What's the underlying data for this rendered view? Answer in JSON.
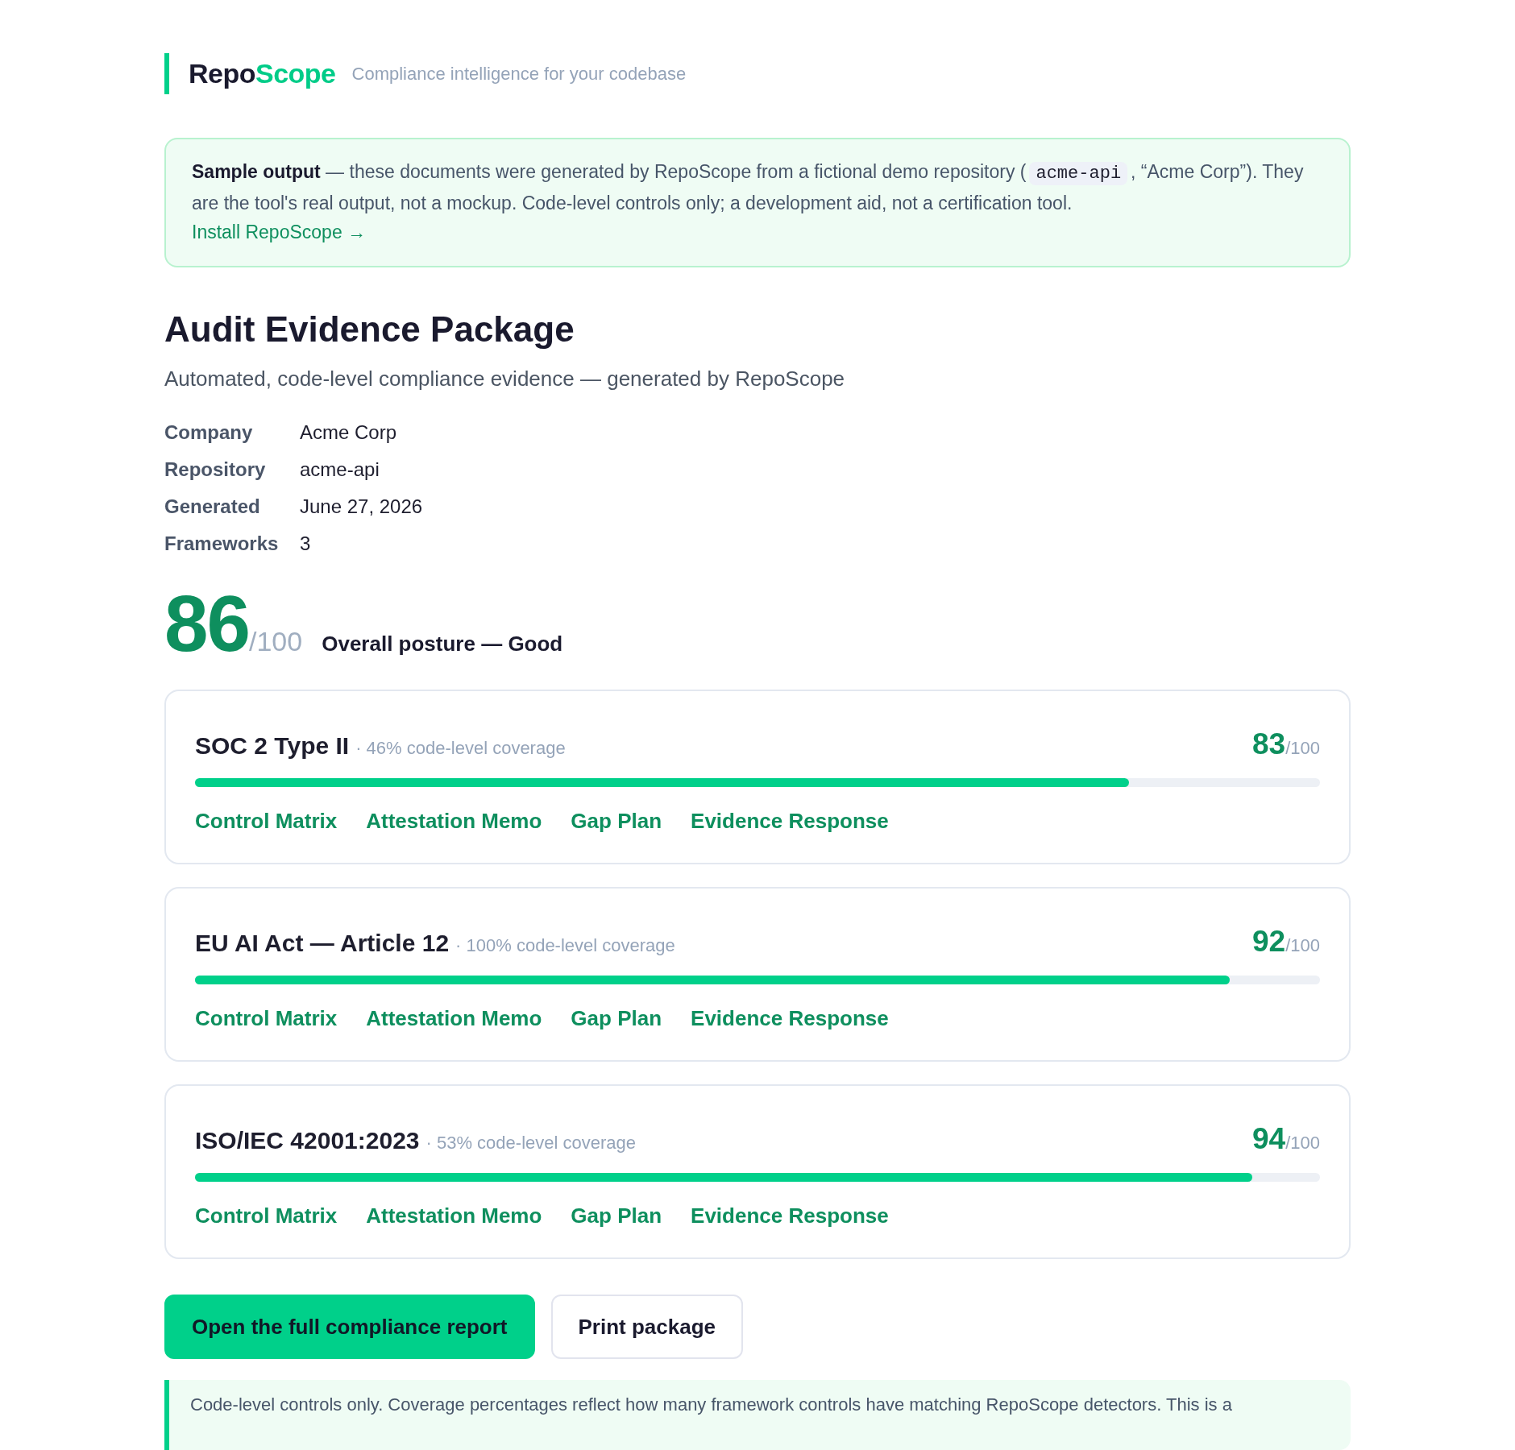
{
  "brand": {
    "name_first": "Repo",
    "name_second": "Scope",
    "tagline": "Compliance intelligence for your codebase"
  },
  "notice": {
    "text_before": "**Sample output** — these documents were generated by RepoScope from a fictional demo repository (",
    "code": "acme-api",
    "text_after": ", “Acme Corp”). They are the tool's real output, not a mockup. Code-level controls only; a development aid, not a certification tool.",
    "link": "Install RepoScope →"
  },
  "page": {
    "title": "Audit Evidence Package",
    "subtitle": "Automated, code-level compliance evidence — generated by RepoScope"
  },
  "meta": [
    {
      "label": "Company",
      "value": "Acme Corp"
    },
    {
      "label": "Repository",
      "value": "acme-api"
    },
    {
      "label": "Generated",
      "value": "June 27, 2026"
    },
    {
      "label": "Frameworks",
      "value": "3"
    }
  ],
  "overall": {
    "score": "86",
    "max": "/100",
    "label": "Overall posture — Good"
  },
  "frameworks": [
    {
      "name": "SOC 2 Type II",
      "coverage": "· 46% code-level coverage",
      "score": "83",
      "max": "/100",
      "level": 0.83,
      "links": [
        "Control Matrix",
        "Attestation Memo",
        "Gap Plan",
        "Evidence Response"
      ]
    },
    {
      "name": "EU AI Act — Article 12",
      "coverage": "· 100% code-level coverage",
      "score": "92",
      "max": "/100",
      "level": 0.92,
      "links": [
        "Control Matrix",
        "Attestation Memo",
        "Gap Plan",
        "Evidence Response"
      ]
    },
    {
      "name": "ISO/IEC 42001:2023",
      "coverage": "· 53% code-level coverage",
      "score": "94",
      "max": "/100",
      "level": 0.94,
      "links": [
        "Control Matrix",
        "Attestation Memo",
        "Gap Plan",
        "Evidence Response"
      ]
    }
  ],
  "buttons": [
    {
      "label": "Open the full compliance report",
      "kind": "primary"
    },
    {
      "label": "Print package",
      "kind": "secondary"
    }
  ],
  "footnote": {
    "text": "Code-level controls only. Coverage percentages reflect how many framework controls have matching RepoScope detectors. This is a"
  }
}
